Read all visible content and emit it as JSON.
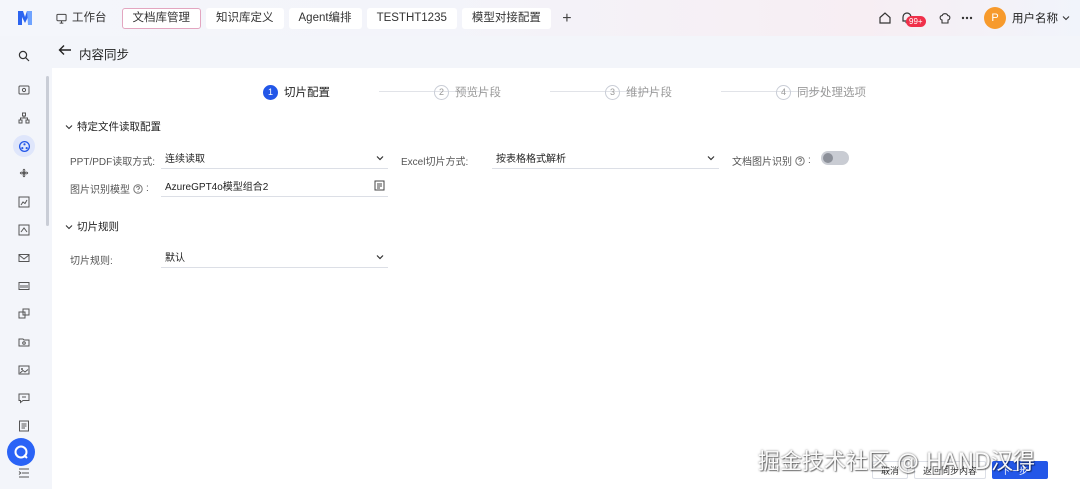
{
  "topbar": {
    "tabs": [
      {
        "label": "工作台"
      },
      {
        "label": "文档库管理"
      },
      {
        "label": "知识库定义"
      },
      {
        "label": "Agent编排"
      },
      {
        "label": "TESTHT1235"
      },
      {
        "label": "模型对接配置"
      }
    ],
    "add_label": "+",
    "notification_badge": "99+",
    "avatar_initial": "P",
    "username": "用户名称"
  },
  "header": {
    "title": "内容同步"
  },
  "steps": [
    {
      "num": "1",
      "label": "切片配置",
      "state": "active"
    },
    {
      "num": "2",
      "label": "预览片段",
      "state": "pending"
    },
    {
      "num": "3",
      "label": "维护片段",
      "state": "pending"
    },
    {
      "num": "4",
      "label": "同步处理选项",
      "state": "pending"
    }
  ],
  "section_file": {
    "title": "特定文件读取配置",
    "ppt_label": "PPT/PDF读取方式:",
    "ppt_value": "连续读取",
    "excel_label": "Excel切片方式:",
    "excel_value": "按表格格式解析",
    "doc_image_label": "文档图片识别",
    "doc_image_suffix": ":",
    "doc_image_enabled": false,
    "image_model_label": "图片识别模型",
    "image_model_suffix": ":",
    "image_model_value": "AzureGPT4o模型组合2"
  },
  "section_rule": {
    "title": "切片规则",
    "rule_label": "切片规则:",
    "rule_value": "默认"
  },
  "footer": {
    "cancel_label": "取消",
    "back_label": "返回同步内容",
    "next_label": "下一步"
  },
  "watermark": "掘金技术社区 @ HAND汉得",
  "colors": {
    "primary": "#2357e8",
    "avatar": "#f79a2c",
    "badge": "#f0304a"
  }
}
